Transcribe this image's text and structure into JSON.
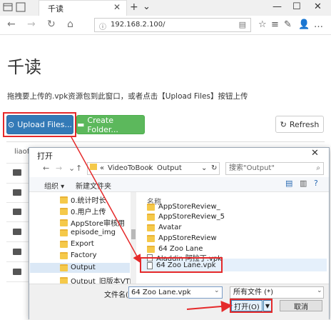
{
  "browser": {
    "tab_title": "千读",
    "tab_close": "✕",
    "new_tab": "+",
    "minimize": "—",
    "maximize": "☐",
    "close": "✕",
    "address": "192.168.2.100/",
    "nav": {
      "back": "←",
      "forward": "→",
      "reload": "↻",
      "home": "⌂"
    },
    "tools": [
      "☆",
      "≡",
      "✎",
      "👤",
      "…"
    ]
  },
  "page": {
    "title": "千读",
    "description": "拖拽要上传的.vpk资源包到此窗口，或者点击【Upload Files】按钮上传",
    "buttons": {
      "upload": "Upload Files...",
      "create_folder": "Create Folder...",
      "refresh": "Refresh"
    },
    "table_header": "liaofc i"
  },
  "dialog": {
    "title": "打开",
    "close": "✕",
    "path": [
      "VideoToBook",
      "Output"
    ],
    "path_prefix": "«",
    "search_placeholder": "搜索\"Output\"",
    "toolbar": {
      "organize": "组织 ▾",
      "new_folder": "新建文件夹"
    },
    "tree": [
      "0.统计时长",
      "0.用户上传",
      "AppStore审核用",
      "episode_img",
      "Export",
      "Factory",
      "Output",
      "Output_旧版本VTB"
    ],
    "column_name": "名称",
    "files": [
      {
        "name": "AppStoreReview_",
        "type": "folder"
      },
      {
        "name": "AppStoreReview_5",
        "type": "folder"
      },
      {
        "name": "Avatar",
        "type": "folder"
      },
      {
        "name": "AppStoreReview",
        "type": "folder"
      },
      {
        "name": "64 Zoo Lane",
        "type": "folder"
      },
      {
        "name": "Aladdin 阿拉丁.vpk",
        "type": "file"
      },
      {
        "name": "64 Zoo Lane.vpk",
        "type": "file"
      }
    ],
    "filename_label": "文件名(N):",
    "filename_value": "64 Zoo Lane.vpk",
    "filetype_value": "所有文件 (*)",
    "open_label": "打开(O)",
    "cancel_label": "取消"
  }
}
